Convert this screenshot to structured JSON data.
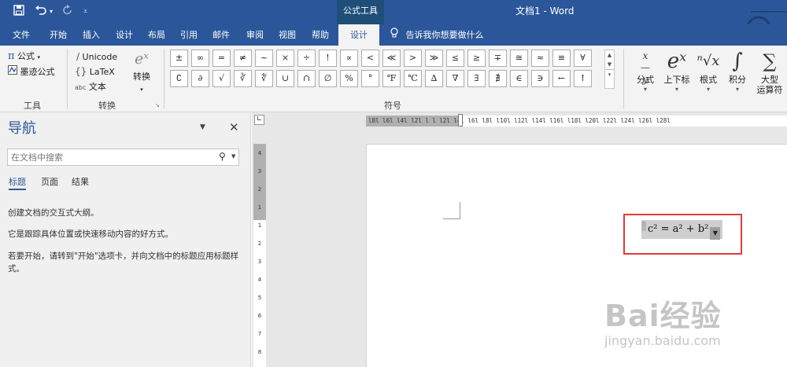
{
  "titlebar": {
    "context_label": "公式工具",
    "doc_title": "文档1  -  Word",
    "save_icon": "save-icon",
    "undo_icon": "undo-icon",
    "redo_icon": "redo-icon",
    "customize_icon": "customize-quick-access-icon"
  },
  "tabs": [
    {
      "label": "文件"
    },
    {
      "label": "开始"
    },
    {
      "label": "插入"
    },
    {
      "label": "设计"
    },
    {
      "label": "布局"
    },
    {
      "label": "引用"
    },
    {
      "label": "邮件"
    },
    {
      "label": "审阅"
    },
    {
      "label": "视图"
    },
    {
      "label": "帮助"
    },
    {
      "label": "设计",
      "active": true
    }
  ],
  "tellme": "告诉我你想要做什么",
  "ribbon": {
    "tools": {
      "equation_label": "公式",
      "ink_label": "墨迹公式",
      "group_label": "工具"
    },
    "conversions": {
      "unicode_label": "Unicode",
      "latex_label": "LaTeX",
      "text_label": "文本",
      "convert_label": "转换",
      "group_label": "转换"
    },
    "symbols": {
      "row1": [
        "±",
        "∞",
        "=",
        "≠",
        "~",
        "×",
        "÷",
        "!",
        "∝",
        "<",
        "≪",
        ">",
        "≫",
        "≤",
        "≥",
        "∓",
        "≅",
        "≈",
        "≡",
        "∀"
      ],
      "row2": [
        "∁",
        "∂",
        "√",
        "∛",
        "∜",
        "∪",
        "∩",
        "∅",
        "%",
        "°",
        "℉",
        "℃",
        "∆",
        "∇",
        "∃",
        "∄",
        "∈",
        "∋",
        "←",
        "↑"
      ],
      "group_label": "符号"
    },
    "structures": [
      {
        "label": "分式",
        "glyph": "x/y"
      },
      {
        "label": "上下标",
        "glyph": "eˣ"
      },
      {
        "label": "根式",
        "glyph": "ⁿ√x"
      },
      {
        "label": "积分",
        "glyph": "∫"
      },
      {
        "label": "大型\n运算符",
        "glyph": "∑"
      }
    ]
  },
  "nav": {
    "title": "导航",
    "search_placeholder": "在文档中搜索",
    "tabs": [
      "标题",
      "页面",
      "结果"
    ],
    "p1": "创建文档的交互式大纲。",
    "p2": "它是跟踪具体位置或快速移动内容的好方式。",
    "p3": "若要开始，请转到\"开始\"选项卡，并向文档中的标题应用标题样式。"
  },
  "ruler": {
    "h_ticks": "l8l l6l l4l l2l l    l  l2l l4l l6l l8l l10l l12l l14l l16l l18l l20l l22l l24l l26l l28l",
    "v_ticks": [
      "4",
      "3",
      "2",
      "1",
      "1",
      "2",
      "3",
      "4",
      "5",
      "6",
      "7",
      "8"
    ]
  },
  "document": {
    "equation": "c² = a² + b²"
  },
  "watermark": {
    "brand": "Bai经验",
    "url": "jingyan.baidu.com"
  }
}
